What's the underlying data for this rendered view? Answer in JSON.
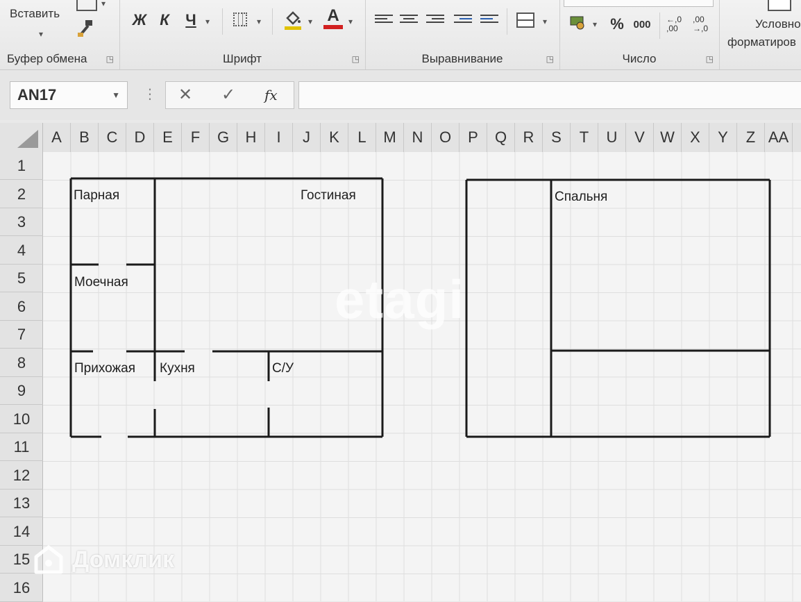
{
  "ribbon": {
    "clipboard": {
      "paste_label": "Вставить",
      "group_label": "Буфер обмена"
    },
    "font": {
      "bold": "Ж",
      "italic": "К",
      "underline": "Ч",
      "group_label": "Шрифт",
      "font_color_letter": "A"
    },
    "alignment": {
      "group_label": "Выравнивание"
    },
    "number": {
      "percent": "%",
      "thousands": "000",
      "dec_increase": "←,0 ,00",
      "dec_decrease": ",00 →,0",
      "group_label": "Число"
    },
    "styles": {
      "conditional_line1": "Условно",
      "conditional_line2": "форматиров"
    }
  },
  "formula_bar": {
    "name_box": "AN17",
    "cancel": "✕",
    "enter": "✓",
    "fx": "fx",
    "value": ""
  },
  "columns": [
    "A",
    "B",
    "C",
    "D",
    "E",
    "F",
    "G",
    "H",
    "I",
    "J",
    "K",
    "L",
    "M",
    "N",
    "O",
    "P",
    "Q",
    "R",
    "S",
    "T",
    "U",
    "V",
    "W",
    "X",
    "Y",
    "Z",
    "AA"
  ],
  "rows": [
    "1",
    "2",
    "3",
    "4",
    "5",
    "6",
    "7",
    "8",
    "9",
    "10",
    "11",
    "12",
    "13",
    "14",
    "15",
    "16"
  ],
  "plan": {
    "rooms": {
      "parnaya": "Парная",
      "gostinaya": "Гостиная",
      "moechnaya": "Моечная",
      "prihozhaya": "Прихожая",
      "kuhnya": "Кухня",
      "su": "С/У",
      "spalnya": "Спальня"
    }
  },
  "watermarks": {
    "etagi": "etagi",
    "domclick": "Домклик"
  },
  "colors": {
    "grid_line": "#d6d6d6",
    "wall": "#1a1a1a",
    "header_bg": "#e3e3e3"
  },
  "icons": [
    "paste-icon",
    "format-painter-icon",
    "borders-icon",
    "fill-color-icon",
    "font-color-icon",
    "align-left-icon",
    "align-center-icon",
    "align-right-icon",
    "indent-decrease-icon",
    "indent-increase-icon",
    "merge-cells-icon",
    "currency-icon",
    "chevron-down-icon",
    "dialog-launcher-icon",
    "cancel-icon",
    "enter-icon",
    "function-icon"
  ]
}
